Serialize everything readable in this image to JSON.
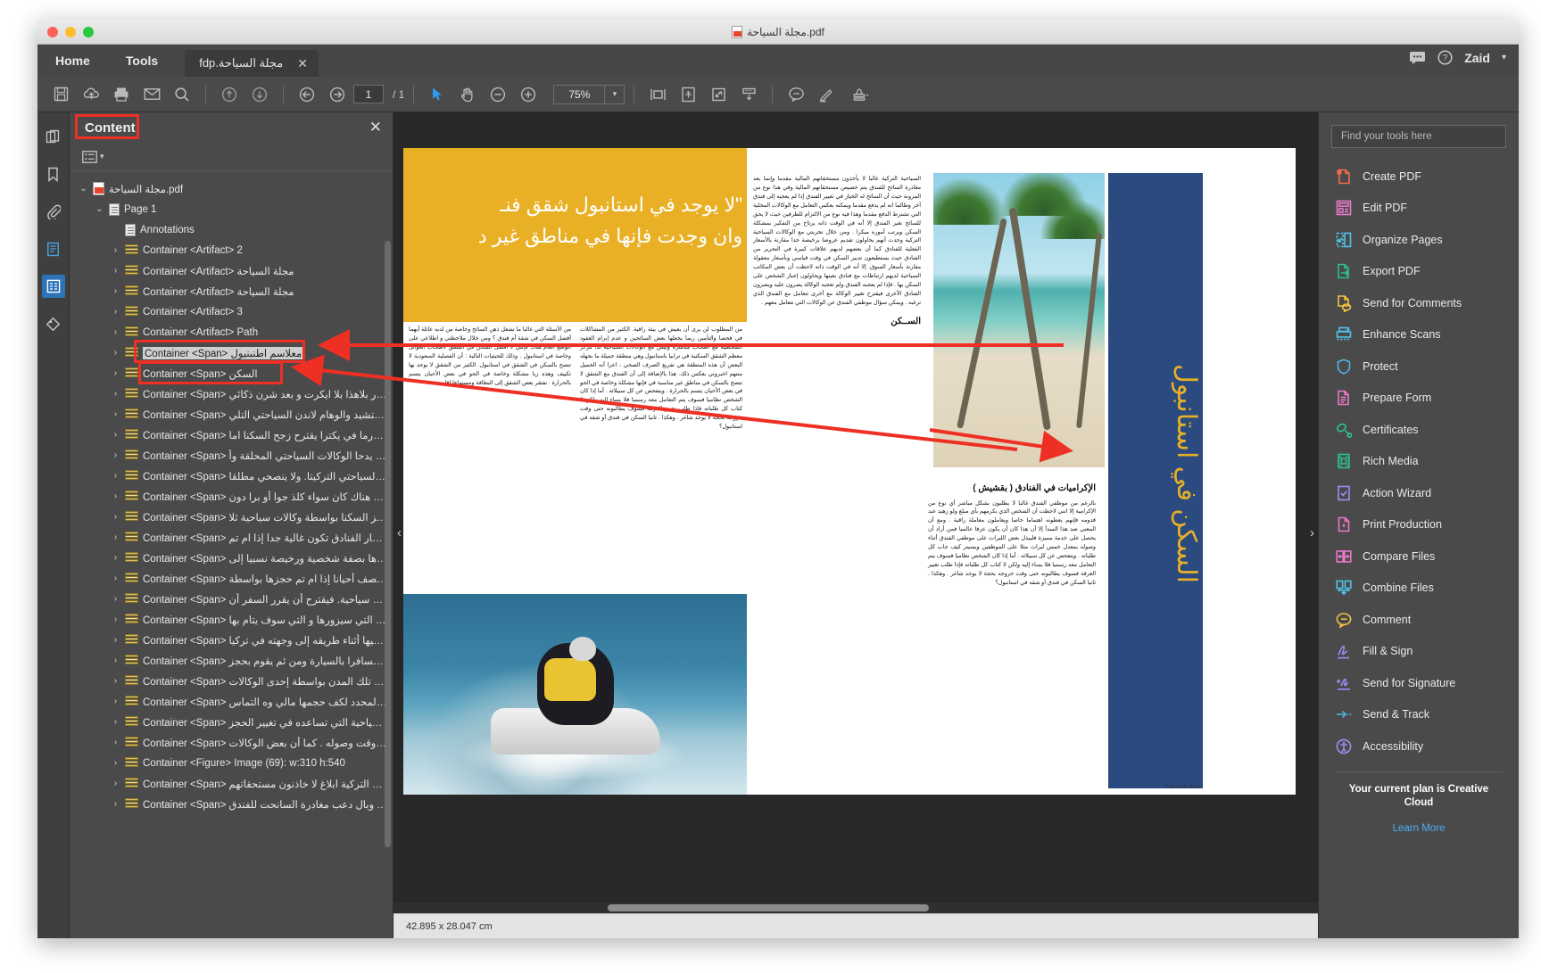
{
  "window": {
    "title": "مجلة السياحة.pdf",
    "title_icon": "pdf-file-icon"
  },
  "menu": {
    "home": "Home",
    "tools": "Tools"
  },
  "doc_tab": {
    "label": "مجلة السياحة.pdf",
    "close": "✕"
  },
  "account": {
    "name": "Zaid",
    "caret": "▾",
    "chat_icon": "chat-bubble-icon",
    "help_icon": "help-circle-icon"
  },
  "toolbar": {
    "page_current": "1",
    "page_total": "/ 1",
    "zoom_value": "75%",
    "zoom_caret": "▾",
    "icons": [
      "save-icon",
      "upload-cloud-icon",
      "print-icon",
      "email-icon",
      "search-icon",
      "page-up-icon",
      "page-down-icon",
      "previous-view-icon",
      "next-view-icon",
      "select-tool-icon",
      "hand-tool-icon",
      "zoom-out-icon",
      "zoom-in-icon",
      "fit-width-icon",
      "pan-and-zoom-icon",
      "fit-page-icon",
      "scroll-mode-icon",
      "comment-icon",
      "highlight-icon",
      "stamp-icon"
    ]
  },
  "rail": {
    "items": [
      "page-thumbnails-icon",
      "bookmarks-icon",
      "attachments-icon",
      "pages-icon",
      "content-panel-icon",
      "tags-icon"
    ]
  },
  "nav_panel": {
    "title": "Content",
    "close": "✕",
    "options_icon": "options-list-icon",
    "options_caret": "▾",
    "tree": [
      {
        "depth": 0,
        "twisty": "⌄",
        "icon": "pdf-file-icon",
        "label": "مجلة السياحة.pdf",
        "rtl": true
      },
      {
        "depth": 1,
        "twisty": "⌄",
        "icon": "page-icon",
        "label": "Page 1",
        "rtl": false
      },
      {
        "depth": 2,
        "twisty": "",
        "icon": "annotations-icon",
        "label": "Annotations",
        "rtl": false
      },
      {
        "depth": 2,
        "twisty": "›",
        "icon": "container-icon",
        "label": "Container <Artifact> 2",
        "rtl": false
      },
      {
        "depth": 2,
        "twisty": "›",
        "icon": "container-icon",
        "label": "Container <Artifact>   مجلة السياحة",
        "rtl": false
      },
      {
        "depth": 2,
        "twisty": "›",
        "icon": "container-icon",
        "label": "Container <Artifact> مجلة السياحة",
        "rtl": false
      },
      {
        "depth": 2,
        "twisty": "›",
        "icon": "container-icon",
        "label": "Container <Artifact> 3",
        "rtl": false
      },
      {
        "depth": 2,
        "twisty": "›",
        "icon": "container-icon",
        "label": "Container <Artifact> Path",
        "rtl": false
      },
      {
        "depth": 2,
        "twisty": "›",
        "icon": "container-icon",
        "label": "Container <Span>  معلاسم اطنبنيول",
        "rtl": false,
        "highlight_text": true
      },
      {
        "depth": 2,
        "twisty": "›",
        "icon": "container-icon",
        "label": "Container <Span> السكن",
        "rtl": false
      },
      {
        "depth": 2,
        "twisty": "›",
        "icon": "container-icon",
        "label": "Container <Span> حمدا تقرر بلاهذا بلا ايكرت و بعد شرن ذكائي",
        "rtl": false
      },
      {
        "depth": 2,
        "twisty": "›",
        "icon": "container-icon",
        "label": "Container <Span> رفسو وحتشيد والوهام لاندن السياحتي التلي",
        "rtl": false
      },
      {
        "depth": 2,
        "twisty": "›",
        "icon": "container-icon",
        "label": "Container <Span> شتروزرما في يكترا يقترح زجح السكنا اما",
        "rtl": false
      },
      {
        "depth": 2,
        "twisty": "›",
        "icon": "container-icon",
        "label": "Container <Span> بواسطة يدحا الوكالات السياحتي المحلقة وأ",
        "rtl": false
      },
      {
        "depth": 2,
        "twisty": "›",
        "icon": "container-icon",
        "label": "Container <Span> الوكالات السياحتي التركيتا. ولا ينصحي مطلقا",
        "rtl": false
      },
      {
        "depth": 2,
        "twisty": "›",
        "icon": "container-icon",
        "label": "Container <Span> التوجيه بلا هناك كان سواء كلذ جوا أو برا دون",
        "rtl": false
      },
      {
        "depth": 2,
        "twisty": "›",
        "icon": "container-icon",
        "label": "Container <Span> حجز السكنا بواسطة وكالات سياحية ثلا",
        "rtl": false
      },
      {
        "depth": 2,
        "twisty": "›",
        "icon": "container-icon",
        "label": "Container <Span> اسعار الفنادق تكون غالية جدا إذا ام تم",
        "rtl": false
      },
      {
        "depth": 2,
        "twisty": "›",
        "icon": "container-icon",
        "label": "Container <Span> حجزها بصفة شخصية ورخيصة نسبيا إلى",
        "rtl": false
      },
      {
        "depth": 2,
        "twisty": "›",
        "icon": "container-icon",
        "label": "Container <Span> اقل من النصف أحيانا إذا ام تم حجزها بواسطة",
        "rtl": false
      },
      {
        "depth": 2,
        "twisty": "›",
        "icon": "container-icon",
        "label": "Container <Span> وكالات سياحية. فيقترح أن يقرر السفر أن",
        "rtl": false
      },
      {
        "depth": 2,
        "twisty": "›",
        "icon": "container-icon",
        "label": "Container <Span> يحدد المدن التي سيزورها و التي سوف يتام بها",
        "rtl": false
      },
      {
        "depth": 2,
        "twisty": "›",
        "icon": "container-icon",
        "label": "Container <Span> أو يبقى فيها أثناء طريقه إلى وجهته في تركيا",
        "rtl": false
      },
      {
        "depth": 2,
        "twisty": "›",
        "icon": "container-icon",
        "label": "Container <Span> إذا كان مسافرا بالسيارة ومن ثم يقوم بحجز",
        "rtl": false
      },
      {
        "depth": 2,
        "twisty": "›",
        "icon": "container-icon",
        "label": "Container <Span> الفنادق في تلك المدن بواسطة إحدى الوكالات",
        "rtl": false
      },
      {
        "depth": 2,
        "twisty": "›",
        "icon": "container-icon",
        "label": "Container <Span> في الوقت المحدد لكف حجمها مالي وه التماس",
        "rtl": false
      },
      {
        "depth": 2,
        "twisty": "›",
        "icon": "container-icon",
        "label": "Container <Span> بوكالته السياحية التي تساعده في تغيير الحجز",
        "rtl": false
      },
      {
        "depth": 2,
        "twisty": "›",
        "icon": "container-icon",
        "label": "Container <Span> ليتوافق مع وقت وصوله . كما أن بعض الوكالات",
        "rtl": false
      },
      {
        "depth": 2,
        "twisty": "›",
        "icon": "container-icon",
        "label": "Container <Figure> Image (69): w:310 h:540",
        "rtl": false
      },
      {
        "depth": 2,
        "twisty": "›",
        "icon": "container-icon",
        "label": "Container <Span> السياحيتة التركية ابلاغ لا خاذنون مستحقاتهم",
        "rtl": false
      },
      {
        "depth": 2,
        "twisty": "›",
        "icon": "container-icon",
        "label": "Container <Span> الخيار مقدما وبال دعب مغادرة السانحت للفندق",
        "rtl": false
      }
    ]
  },
  "document": {
    "quote_line1": "\"لا يوجد في استانبول شقق فنـ",
    "quote_line2": "وان وجدت فإنها في مناطق غير د",
    "blue_banner_text": "السكن في استانبول",
    "heading_sakan": "الســكن",
    "heading_ikramiyat": "الإكراميات في الفنادق ( بقشيش )",
    "footer": "مجلة السياحة    ٢",
    "col_a": "من الأسئلة التي غالبا ما تشغل ذهن السائح وخاصة من لديه عائلة أيهما أفضل السكن في شقة أم فندق ؟ ومن خلال ملاحظتي و اطلاعي على الوضع العام هناك فإنني لا أفضل السكن في الشقق لأصحاب العوائل وخاصة في استانبول . وذلك للحيثيات التالية : أن الفصلية السعودية لا تنصح بالسكن في الشقق في استانبول. الكثير من الشقق لا يوجد بها تكييف وهذه زيا مشكلة وخاصة في الجو في بعض الأحيان يتسم بالحرارة . نفتقر بعض الشقق إلى النظافة ومستواها اقل",
    "col_b": "من المطلوب لن يرى أن يعيش في بيئة راقية. الكثير من المشاكلات في فحصا والتأمين ربما يجعلها بعض السائحين و عدم إبرام العقود الشخصية مع أصحاب مباشرة وليس مع الوكالات السياحية لذا تتركز معظم الشقق السكنية في ترابيا باستانبول وهي منطقة جميلة ما بجهله البعض أن هذه المنطقة هي تفريغ الصرف الصحي ، اعرا أنه الحميل منتهم اخبروني بعكس ذلك. هذا بالإضافة إلى أن الفندق مع الشقق لا تنصح بالسكن في مناطق غير مناسبة في فإنها مشكلة وخاصة في الجو في بعض الأحيان يتسم بالحرارة . ويتفحص عن كل سبيلائه . أما إذا كان الشخص نظاميا فسوف يتم التعامل معه رسميا فلا يساء إليه ولكن لا كتاب كل طلباته فإذا طلب تغيير الغرفة فسوف يطالبونه حتى وقت خروجه بحجة لا يوجد شاغر . وهكذا . ثانيا السكن في فندق أو شقه في استانبول؟",
    "col_c": "السياحية التركية غالبا لا يأخذون مستحقاتهم المالية مقدما وإنما بعد مغادرة السائح للفندق يتم خصيص مستحقاتهم المالية وفي هذا نوع من المرونة حيث أن السائح له الخيار في تغيير الفندق إذا لم يعجبه إلى فندق آخر وطالما انه لم يدفع مقدما ويمكنه بعكس التعامل مع الوكالات المحلية التي تشترط الدفع مقدما وهذا فيه نوع من الالتزام للطرفين حيث لا يحق للسائح تغير الفندق إلا أنه في الوقت ذاته يرتاح من التفكير بمشكلة السكن ويرتب أموره مبكرا . ومن خلال تجربتي مع الوكالات السياحية التركية وجدت أنهم يحاولون تقديم عروضا برخيصة جدا مقارنة بالأسعار الفعلية للفنادق كما أن بعضهم لديهم علاقات كبيرة في التحرير من الفنادق حيث يستطيعون تدبير السكن في وقت قياسي وبأسعار معقولة مقارنة بأسعار السوق. إلا أنه في الوقت ذاته لاحظت أن بعض المكاتب السياحية لديهم ارتباطات مع فنادق بعينها ويحاولون إجبار الشخص على السكن بها . فإذا لم يعجبه الفندق ولم تعجبه الوكالة يصرون عليه ويصرون الفنادق الأخرى فيقترح تغيير الوكالة مع أخرى تتعامل مع الفندق الذي ترغبه . ويمكن سؤال موظفي الفندق عن الوكالات التي تتعامل معهم .",
    "col_d": "بالرغم من موظفي الفندق غالبا لا يطلبون بشكل مباشر أي نوع من الإكرامية إلا انني لاحظت أن الشخص الذي يكرمهم بأي مبلغ ولو زهيد عند قدومه فإنهم يعطونه اهتماما خاصا ويعاملون معاملة راقية . ومع أن المعني ضد هذا المبدأ إلا أن هذا كان أن يكون عرفا عالميا فمن أراد أن يحصل على خدمة مميزة فليبذل بعض الليرات على موظفي الفندق أثناء وصوله بمعدل خمس ليرات مثلا على الموظفين وبسيتر كيف جاب كل طلباته . ويتفحص عن كل سبيلائه . أما إذا كان الشخص نظاميا فسوف يتم التعامل معه رسميا فلا يساء إليه ولكن لا كتاب كل طلباته فإذا طلب تغيير الغرفة فسوف يطالبونه حتى وقت خروجه بحجة لا يوجد شاغر . وهكذا . ثانيا السكن في فندق أو شقه في استانبول؟"
  },
  "statusbar": {
    "dimensions": "42.895 x 28.047 cm"
  },
  "tools": {
    "search_placeholder": "Find your tools here",
    "items": [
      {
        "label": "Create PDF",
        "icon": "create-pdf-icon",
        "color": "#f26c4f"
      },
      {
        "label": "Edit PDF",
        "icon": "edit-pdf-icon",
        "color": "#e879c8"
      },
      {
        "label": "Organize Pages",
        "icon": "organize-pages-icon",
        "color": "#4fc3e8"
      },
      {
        "label": "Export PDF",
        "icon": "export-pdf-icon",
        "color": "#2dc08a"
      },
      {
        "label": "Send for Comments",
        "icon": "send-for-comments-icon",
        "color": "#f2c33d"
      },
      {
        "label": "Enhance Scans",
        "icon": "enhance-scans-icon",
        "color": "#4fc3e8"
      },
      {
        "label": "Protect",
        "icon": "shield-icon",
        "color": "#4fb8e8"
      },
      {
        "label": "Prepare Form",
        "icon": "prepare-form-icon",
        "color": "#e879c8"
      },
      {
        "label": "Certificates",
        "icon": "certificates-icon",
        "color": "#2dc08a"
      },
      {
        "label": "Rich Media",
        "icon": "rich-media-icon",
        "color": "#2dc08a"
      },
      {
        "label": "Action Wizard",
        "icon": "action-wizard-icon",
        "color": "#9d8df1"
      },
      {
        "label": "Print Production",
        "icon": "print-production-icon",
        "color": "#e879c8"
      },
      {
        "label": "Compare Files",
        "icon": "compare-files-icon",
        "color": "#e879c8"
      },
      {
        "label": "Combine Files",
        "icon": "combine-files-icon",
        "color": "#4fc3e8"
      },
      {
        "label": "Comment",
        "icon": "comment-icon",
        "color": "#f2c33d"
      },
      {
        "label": "Fill & Sign",
        "icon": "fill-and-sign-icon",
        "color": "#9d8df1"
      },
      {
        "label": "Send for Signature",
        "icon": "send-for-signature-icon",
        "color": "#9d8df1"
      },
      {
        "label": "Send & Track",
        "icon": "send-and-track-icon",
        "color": "#4fb8e8"
      },
      {
        "label": "Accessibility",
        "icon": "accessibility-icon",
        "color": "#9d8df1"
      }
    ],
    "plan_text": "Your current plan is Creative Cloud",
    "learn_more": "Learn More"
  },
  "colors": {
    "accent_highlight": "#ee2f24",
    "chrome_dark": "#4a4a4a",
    "magazine_yellow": "#e9b026",
    "magazine_blue": "#2a4a80",
    "link_blue": "#49b0f5"
  }
}
